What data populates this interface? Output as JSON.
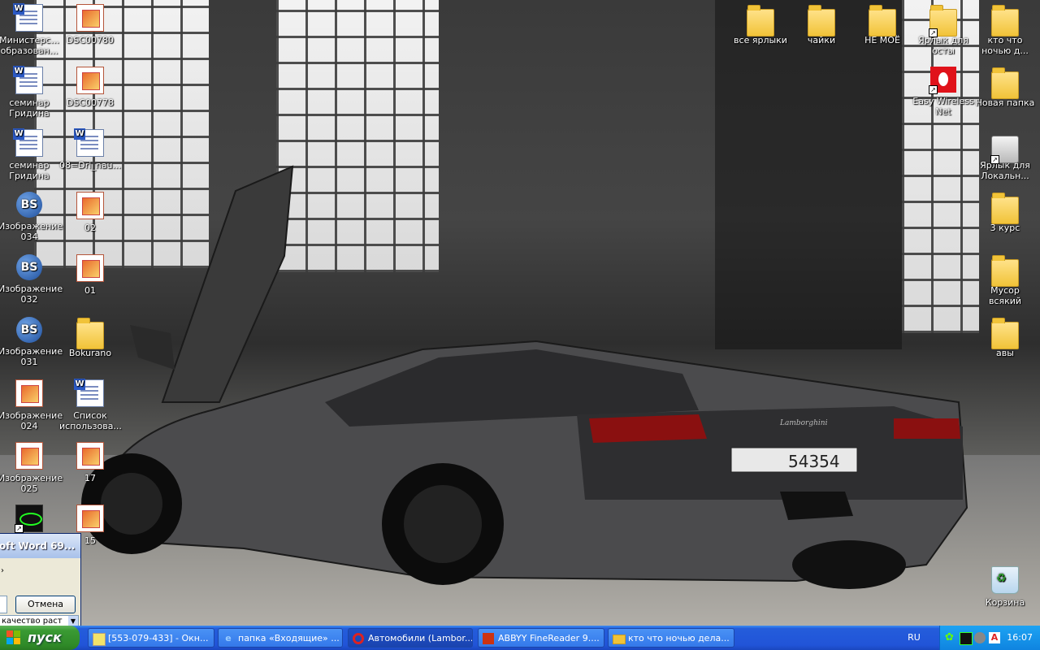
{
  "desktop_icons": [
    {
      "label": "Министерс... образован...",
      "type": "doc"
    },
    {
      "label": "DSC00780",
      "type": "img"
    },
    {
      "label": "семинар Гридина",
      "type": "doc"
    },
    {
      "label": "DSC00778",
      "type": "img"
    },
    {
      "label": "семинар Гридина",
      "type": "doc"
    },
    {
      "label": "08=Dri_nau...",
      "type": "doc"
    },
    {
      "label": "Изображение 034",
      "type": "bs"
    },
    {
      "label": "02",
      "type": "img"
    },
    {
      "label": "Изображение 032",
      "type": "bs"
    },
    {
      "label": "01",
      "type": "img"
    },
    {
      "label": "Изображение 031",
      "type": "bs"
    },
    {
      "label": "Bokurano",
      "type": "folder"
    },
    {
      "label": "Изображение 024",
      "type": "img"
    },
    {
      "label": "Список использова...",
      "type": "doc"
    },
    {
      "label": "Изображение 025",
      "type": "img"
    },
    {
      "label": "17",
      "type": "img"
    },
    {
      "label": "",
      "type": "app"
    },
    {
      "label": "15",
      "type": "img"
    },
    {
      "label": "все ярлыки",
      "type": "folder"
    },
    {
      "label": "чайки",
      "type": "folder"
    },
    {
      "label": "НЕ МОЁ",
      "type": "folder"
    },
    {
      "label": "Ярлык для осты",
      "type": "folder"
    },
    {
      "label": "кто что ночью д...",
      "type": "folder"
    },
    {
      "label": "Easy Wireless Net",
      "type": "redapp"
    },
    {
      "label": "Новая папка",
      "type": "folder"
    },
    {
      "label": "Ярлык для Локальн...",
      "type": "drive"
    },
    {
      "label": "3 курс",
      "type": "folder"
    },
    {
      "label": "Мусор всякий",
      "type": "folder"
    },
    {
      "label": "авы",
      "type": "folder"
    },
    {
      "label": "Корзина",
      "type": "recycle"
    }
  ],
  "dialog": {
    "title": "oft Word 69...",
    "arrow": "›",
    "cancel_label": "Отмена",
    "combo_value": "качество раст"
  },
  "car": {
    "plate": "54354",
    "brand_badge": "Lamborghini"
  },
  "taskbar": {
    "start_label": "пуск",
    "tasks": [
      {
        "label": "[553-079-433] - Окн..."
      },
      {
        "label": "папка «Входящие» ..."
      },
      {
        "label": "Автомобили (Lambor..."
      },
      {
        "label": "ABBYY FineReader 9...."
      },
      {
        "label": "кто что ночью дела..."
      }
    ],
    "language": "RU",
    "clock": "16:07"
  },
  "colors": {
    "taskbar": "#245ddb",
    "start": "#3a9a33",
    "tray": "#0f84e0"
  }
}
